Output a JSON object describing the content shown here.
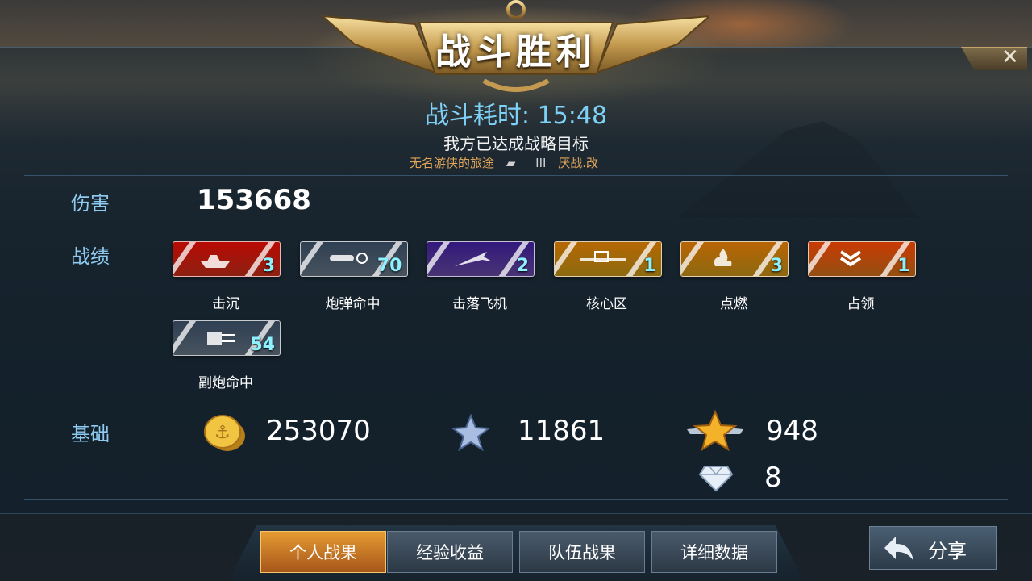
{
  "header": {
    "title": "战斗胜利",
    "battle_time": "战斗耗时: 15:48",
    "objective": "我方已达成战略目标",
    "player_name": "无名游侠的旅途",
    "ship_tier": "III",
    "ship_name": "厌战.改",
    "close_symbol": "✕"
  },
  "labels": {
    "damage": "伤害",
    "achievements": "战绩",
    "base": "基础"
  },
  "damage_value": "153668",
  "achievements": [
    {
      "label": "击沉",
      "count": "3",
      "color": "#d8331c",
      "icon": "sinking-ship-icon"
    },
    {
      "label": "炮弹命中",
      "count": "70",
      "color": "#6e7f91",
      "icon": "shell-hit-icon"
    },
    {
      "label": "击落飞机",
      "count": "2",
      "color": "#7150b2",
      "icon": "plane-down-icon"
    },
    {
      "label": "核心区",
      "count": "1",
      "color": "#d7a319",
      "icon": "citadel-icon"
    },
    {
      "label": "点燃",
      "count": "3",
      "color": "#d9a01b",
      "icon": "fire-icon"
    },
    {
      "label": "占领",
      "count": "1",
      "color": "#e27a1c",
      "icon": "capture-icon"
    },
    {
      "label": "副炮命中",
      "count": "54",
      "color": "#6e7f91",
      "icon": "secondary-gun-icon"
    }
  ],
  "base": {
    "coins": "253070",
    "ship_exp": "11861",
    "captain_exp": "948",
    "diamonds": "8"
  },
  "tabs": [
    {
      "label": "个人战果",
      "active": true
    },
    {
      "label": "经验收益",
      "active": false
    },
    {
      "label": "队伍战果",
      "active": false
    },
    {
      "label": "详细数据",
      "active": false
    }
  ],
  "share_label": "分享"
}
